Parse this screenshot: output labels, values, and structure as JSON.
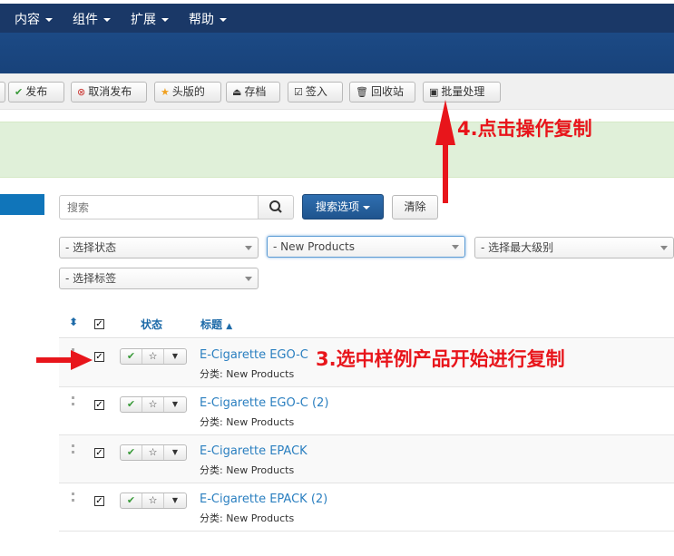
{
  "top_menu": [
    {
      "label": "内容"
    },
    {
      "label": "组件"
    },
    {
      "label": "扩展"
    },
    {
      "label": "帮助"
    }
  ],
  "toolbar": {
    "publish": "发布",
    "unpublish": "取消发布",
    "featured": "头版的",
    "archive": "存档",
    "checkin": "签入",
    "trash": "回收站",
    "batch": "批量处理"
  },
  "search": {
    "placeholder": "搜索",
    "options_label": "搜索选项",
    "clear_label": "清除"
  },
  "filters": {
    "status": "- 选择状态",
    "category": "- New Products",
    "max_level": "- 选择最大级别",
    "tag": "- 选择标签"
  },
  "table": {
    "col_status": "状态",
    "col_title": "标题",
    "rows": [
      {
        "title": "E-Cigarette EGO-C",
        "category": "分类: New Products"
      },
      {
        "title": "E-Cigarette EGO-C (2)",
        "category": "分类: New Products"
      },
      {
        "title": "E-Cigarette EPACK",
        "category": "分类: New Products"
      },
      {
        "title": "E-Cigarette EPACK (2)",
        "category": "分类: New Products"
      }
    ]
  },
  "annotations": {
    "step4": "4.点击操作复制",
    "step3": "3.选中样例产品开始进行复制",
    "color": "#e8151b"
  }
}
